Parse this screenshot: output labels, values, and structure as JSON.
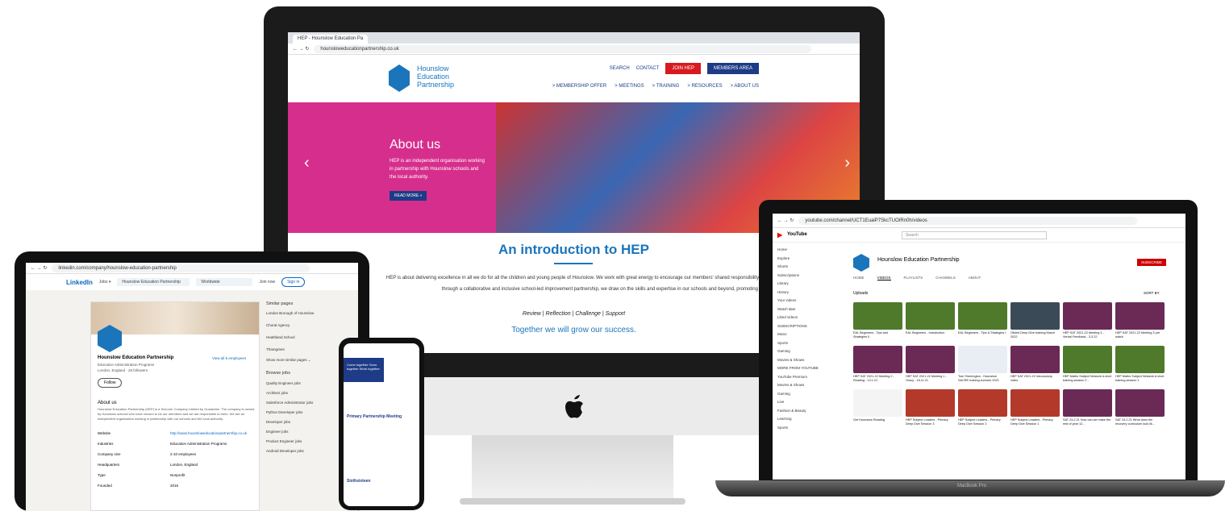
{
  "imac": {
    "tab_title": "HEP - Hounslow Education Pa",
    "url": "hounsloweducationpartnership.co.uk",
    "logo_text": "Hounslow Education Partnership",
    "topnav": [
      "SEARCH",
      "CONTACT"
    ],
    "join": "JOIN HEP",
    "members": "MEMBERS AREA",
    "mainnav": [
      "> MEMBERSHIP OFFER",
      "> MEETINGS",
      "> TRAINING",
      "> RESOURCES",
      "> ABOUT US"
    ],
    "hero_title": "About us",
    "hero_text": "HEP is an independent organisation working in partnership with Hounslow schools and the local authority.",
    "hero_button": "READ MORE »",
    "intro_title": "An introduction to HEP",
    "intro_text": "HEP is about delivering excellence in all we do for all the children and young people of Hounslow. We work with great energy to encourage our members' shared responsibility, collective moral purpose and vision. Achieved through a collaborative and inclusive school-led improvement partnership, we draw on the skills and expertise in our schools and beyond, promoting a rigorous culture of:",
    "culture": "Review | Reflection | Challenge | Support",
    "together": "Together we will grow our success."
  },
  "tablet": {
    "url": "linkedin.com/company/hounslow-education-partnership",
    "logo": "LinkedIn",
    "jobs": "Jobs ▾",
    "search_value": "Hounslow Education Partnership",
    "location": "Worldwide",
    "join": "Join now",
    "signin": "Sign in",
    "company": "Hounslow Education Partnership",
    "industry": "Education Administration Programs",
    "location_line": "London, England · 28 followers",
    "view_employees": "View all 5 employees",
    "follow": "Follow",
    "about_head": "About us",
    "about_text": "Hounslow Education Partnership (HEP) is a Schools' Company Limited by Guarantee. The company is owned by Hounslow schools who have chosen to be our members and we are responsible to them. We are an independent organisation working in partnership with our schools and the local authority.",
    "details": [
      {
        "k": "Website",
        "v": "http://www.hounsloweducationpartnership.co.uk"
      },
      {
        "k": "Industries",
        "v": "Education Administration Programs"
      },
      {
        "k": "Company size",
        "v": "2-10 employees"
      },
      {
        "k": "Headquarters",
        "v": "London, England"
      },
      {
        "k": "Type",
        "v": "Nonprofit"
      },
      {
        "k": "Founded",
        "v": "2016"
      }
    ],
    "similar_head": "Similar pages",
    "similar": [
      "London Borough of Hounslow",
      "Choral Agency",
      "Heathland School",
      "Thamgreen"
    ],
    "show_more": "Show more similar pages ⌄",
    "browse_head": "Browse jobs",
    "jobs_list": [
      "Quality Engineer jobs",
      "Architect jobs",
      "Salesforce Administrator jobs",
      "Python Developer jobs",
      "Developer jobs",
      "Engineer jobs",
      "Product Engineer jobs",
      "Android Developer jobs"
    ]
  },
  "phone": {
    "banner": "Come together Grow together Work together",
    "link1": "Primary Partnership Meeting",
    "link2": "Sixthsixteen"
  },
  "macbook": {
    "url": "youtube.com/channel/UCT1EuaiP7SkcTUOIRn0h/videos",
    "search": "Search",
    "channel": "Hounslow Education Partnership",
    "subscribe": "SUBSCRIBE",
    "tabs": [
      "HOME",
      "VIDEOS",
      "PLAYLISTS",
      "CHANNELS",
      "ABOUT"
    ],
    "uploads": "Uploads",
    "sort": "SORT BY",
    "sidebar": [
      "Home",
      "Explore",
      "Shorts",
      "Subscriptions",
      "Library",
      "History",
      "Your videos",
      "Watch later",
      "Liked videos",
      "SUBSCRIPTIONS",
      "Music",
      "Sports",
      "Gaming",
      "Movies & Shows",
      "MORE FROM YOUTUBE",
      "YouTube Premium",
      "Movies & Shows",
      "Gaming",
      "Live",
      "Fashion & Beauty",
      "Learning",
      "Sports"
    ],
    "videos": [
      {
        "t": "EAL Beginners - Tips and Strategies II",
        "c": "#4f7a2b"
      },
      {
        "t": "EAL Beginners - Introduction",
        "c": "#4f7a2b"
      },
      {
        "t": "EAL Beginners - Tips & Strategies I",
        "c": "#4f7a2b"
      },
      {
        "t": "Ofsted Deep Dive training March 2022",
        "c": "#3b4a57"
      },
      {
        "t": "HEP SAT 2021-22 Meeting 3 - Verbal Feedback - 3.3.22",
        "c": "#6b2a55"
      },
      {
        "t": "HEP SAT 2021-22 Meeting 3 pre watch",
        "c": "#6b2a55"
      },
      {
        "t": "HEP SAT 2021-22 Meeting 2 - Reading - 13.1.21",
        "c": "#6b2a55"
      },
      {
        "t": "HEP SAT 2021-22 Meeting 1 - Oracy - 18.11.21",
        "c": "#6b2a55"
      },
      {
        "t": "Tom Sherrington - Hounslow SACRE training summer 2021",
        "c": "#e9eef5"
      },
      {
        "t": "HEP SAT 2021-22 Introductory video",
        "c": "#6b2a55"
      },
      {
        "t": "HEP Maths Subject Network A-level training session 2 -",
        "c": "#4f7a2b"
      },
      {
        "t": "HEP Maths Subject Network A-level training session 1",
        "c": "#4f7a2b"
      },
      {
        "t": "Get Hounslow Reading",
        "c": "#f4f4f4"
      },
      {
        "t": "HEP Subject Leaders - Primary Deep Dive Session 3",
        "c": "#b33a2a"
      },
      {
        "t": "HEP Subject Leaders - Primary Deep Dive Session 2",
        "c": "#b33a2a"
      },
      {
        "t": "HEP Subject Leaders - Primary Deep Dive Session 1",
        "c": "#b33a2a"
      },
      {
        "t": "SAT 24.2.21 How can we make the rest of year 12...",
        "c": "#6b2a55"
      },
      {
        "t": "SAT 24.2.21 What does the recovery curriculum look lik...",
        "c": "#6b2a55"
      }
    ],
    "label": "MacBook Pro"
  }
}
